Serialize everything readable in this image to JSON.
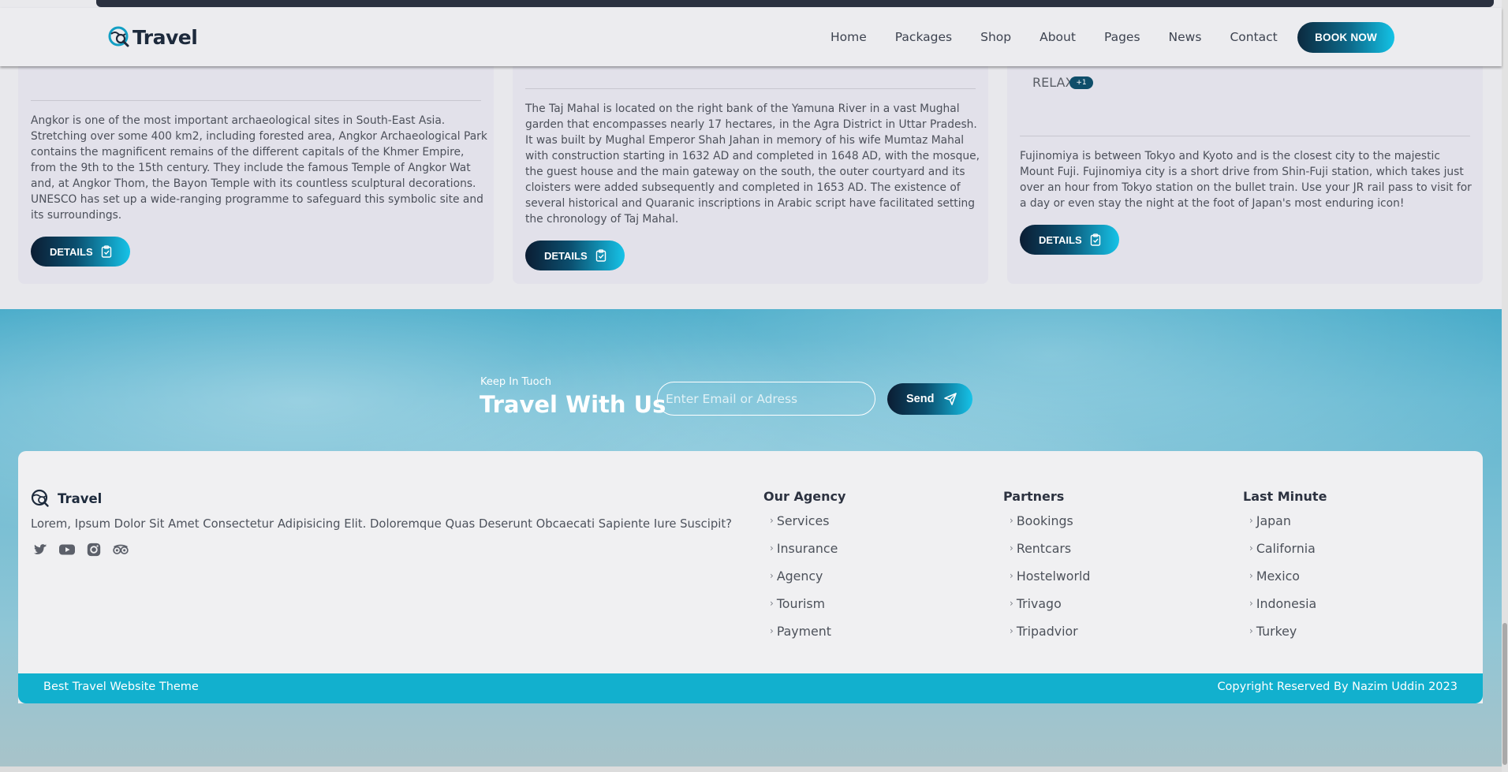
{
  "header": {
    "logo_text": "Travel",
    "nav": [
      "Home",
      "Packages",
      "Shop",
      "About",
      "Pages",
      "News",
      "Contact"
    ],
    "book_now": "BOOK NOW"
  },
  "cards": [
    {
      "text": "Angkor is one of the most important archaeological sites in South-East Asia. Stretching over some 400 km2, including forested area, Angkor Archaeological Park contains the magnificent remains of the different capitals of the Khmer Empire, from the 9th to the 15th century. They include the famous Temple of Angkor Wat and, at Angkor Thom, the Bayon Temple with its countless sculptural decorations. UNESCO has set up a wide-ranging programme to safeguard this symbolic site and its surroundings.",
      "button": "DETAILS"
    },
    {
      "text": "The Taj Mahal is located on the right bank of the Yamuna River in a vast Mughal garden that encompasses nearly 17 hectares, in the Agra District in Uttar Pradesh. It was built by Mughal Emperor Shah Jahan in memory of his wife Mumtaz Mahal with construction starting in 1632 AD and completed in 1648 AD, with the mosque, the guest house and the main gateway on the south, the outer courtyard and its cloisters were added subsequently and completed in 1653 AD. The existence of several historical and Quaranic inscriptions in Arabic script have facilitated setting the chronology of Taj Mahal.",
      "button": "DETAILS"
    },
    {
      "tag": "RELAX",
      "badge": "+1",
      "text": "Fujinomiya is between Tokyo and Kyoto and is the closest city to the majestic Mount Fuji. Fujinomiya city is a short drive from Shin-Fuji station, which takes just over an hour from Tokyo station on the bullet train. Use your JR rail pass to visit for a day or even stay the night at the foot of Japan's most enduring icon!",
      "button": "DETAILS"
    }
  ],
  "newsletter": {
    "eyebrow": "Keep In Tuoch",
    "title": "Travel With Us",
    "placeholder": "Enter Email or Adress",
    "send": "Send"
  },
  "footer": {
    "logo_text": "Travel",
    "description": "Lorem, Ipsum Dolor Sit Amet Consectetur Adipisicing Elit. Doloremque Quas Deserunt Obcaecati Sapiente Iure Suscipit?",
    "socials": [
      "twitter-icon",
      "youtube-icon",
      "instagram-icon",
      "tripadvisor-icon"
    ],
    "columns": [
      {
        "title": "Our Agency",
        "items": [
          "Services",
          "Insurance",
          "Agency",
          "Tourism",
          "Payment"
        ]
      },
      {
        "title": "Partners",
        "items": [
          "Bookings",
          "Rentcars",
          "Hostelworld",
          "Trivago",
          "Tripadvior"
        ]
      },
      {
        "title": "Last Minute",
        "items": [
          "Japan",
          "California",
          "Mexico",
          "Indonesia",
          "Turkey"
        ]
      }
    ],
    "bottom_left": "Best Travel Website Theme",
    "bottom_right": "Copyright Reserved By Nazim Uddin 2023"
  },
  "colors": {
    "accent": "#12b0ce",
    "dark": "#0b1d33",
    "brand_text": "#1d2a3c"
  }
}
